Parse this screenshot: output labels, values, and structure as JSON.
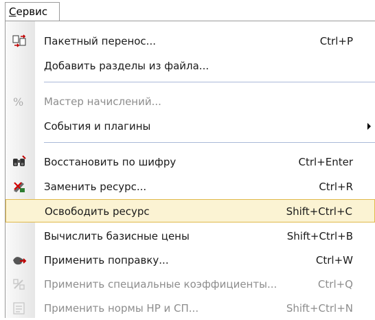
{
  "menubar": {
    "title_prefix": "С",
    "title_rest": "ервис"
  },
  "menu": {
    "items": [
      {
        "label": "Пакетный перенос...",
        "shortcut": "Ctrl+P",
        "icon": "batch-transfer-icon",
        "enabled": true
      },
      {
        "label": "Добавить разделы из файла...",
        "shortcut": "",
        "icon": "",
        "enabled": true
      },
      {
        "label": "Мастер начислений...",
        "shortcut": "",
        "icon": "percent-icon",
        "enabled": false
      },
      {
        "label": "События и плагины",
        "shortcut": "",
        "icon": "",
        "enabled": true,
        "submenu": true
      },
      {
        "label": "Восстановить по шифру",
        "shortcut": "Ctrl+Enter",
        "icon": "binoculars-icon",
        "enabled": true
      },
      {
        "label": "Заменить ресурс...",
        "shortcut": "Ctrl+R",
        "icon": "replace-resource-icon",
        "enabled": true
      },
      {
        "label": "Освободить ресурс",
        "shortcut": "Shift+Ctrl+C",
        "icon": "",
        "enabled": true,
        "highlighted": true
      },
      {
        "label": "Вычислить базисные цены",
        "shortcut": "Shift+Ctrl+B",
        "icon": "",
        "enabled": true
      },
      {
        "label": "Применить поправку...",
        "shortcut": "Ctrl+W",
        "icon": "apply-correction-icon",
        "enabled": true
      },
      {
        "label": "Применить специальные коэффициенты...",
        "shortcut": "Ctrl+Q",
        "icon": "special-coefficients-icon",
        "enabled": false
      },
      {
        "label": "Применить нормы НР и СП...",
        "shortcut": "Shift+Ctrl+N",
        "icon": "norms-icon",
        "enabled": false
      }
    ]
  }
}
